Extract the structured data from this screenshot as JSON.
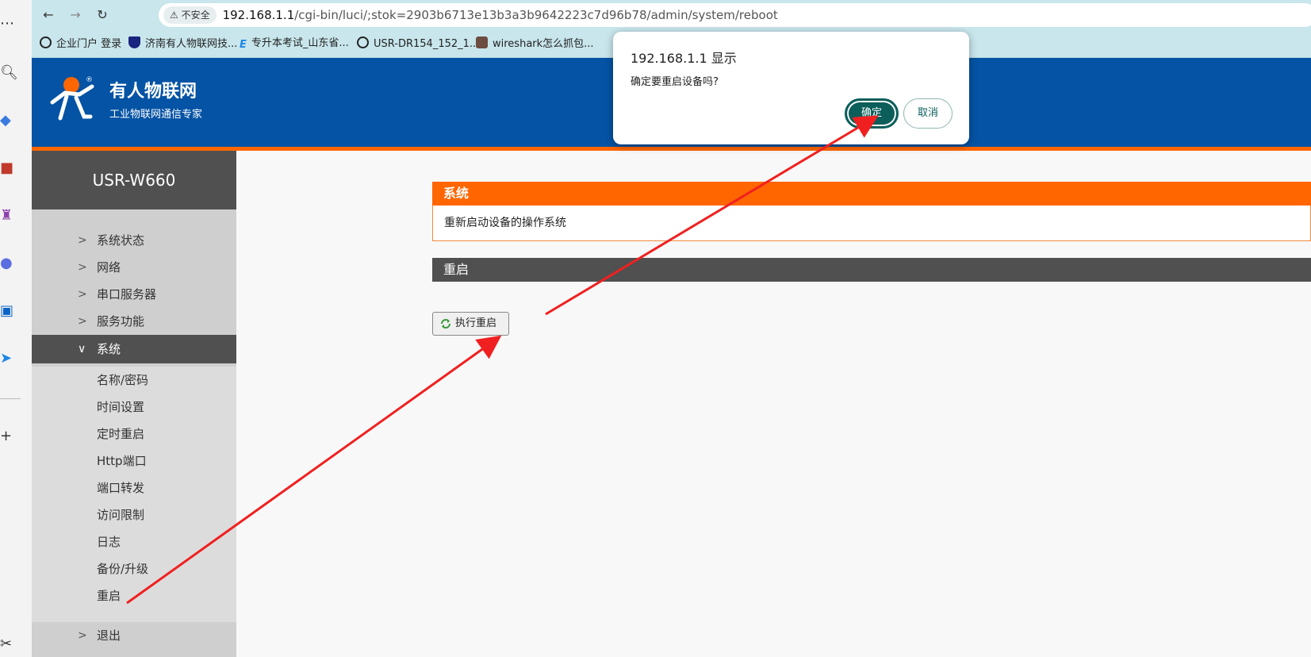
{
  "browser": {
    "insecure_label": "不安全",
    "url_host": "192.168.1.1",
    "url_path": "/cgi-bin/luci/;stok=2903b6713e13b3a3b9642223c7d96b78/admin/system/reboot",
    "bookmarks": [
      {
        "label": "企业门户 登录",
        "icon": "globe-icon",
        "color": "#222222"
      },
      {
        "label": "济南有人物联网技...",
        "icon": "shield-icon",
        "color": "#1a237e"
      },
      {
        "label": "专升本考试_山东省...",
        "icon": "e-logo-icon",
        "color": "#1e88e5"
      },
      {
        "label": "USR-DR154_152_1...",
        "icon": "globe-icon",
        "color": "#222222"
      },
      {
        "label": "wireshark怎么抓包...",
        "icon": "avatar-icon",
        "color": "#6d4c41"
      }
    ]
  },
  "header": {
    "brand": "有人物联网",
    "slogan": "工业物联网通信专家",
    "bg_color": "#0453a4",
    "accent_color": "#ff6600"
  },
  "sidebar": {
    "device": "USR-W660",
    "menu": [
      {
        "label": "系统状态",
        "expanded": false
      },
      {
        "label": "网络",
        "expanded": false
      },
      {
        "label": "串口服务器",
        "expanded": false
      },
      {
        "label": "服务功能",
        "expanded": false
      },
      {
        "label": "系统",
        "expanded": true
      }
    ],
    "submenu": [
      "名称/密码",
      "时间设置",
      "定时重启",
      "Http端口",
      "端口转发",
      "访问限制",
      "日志",
      "备份/升级",
      "重启"
    ],
    "logout": "退出"
  },
  "content": {
    "section_title": "系统",
    "section_desc": "重新启动设备的操作系统",
    "reboot_title": "重启",
    "reboot_button": "执行重启"
  },
  "dialog": {
    "title": "192.168.1.1 显示",
    "message": "确定要重启设备吗?",
    "ok": "确定",
    "cancel": "取消"
  }
}
